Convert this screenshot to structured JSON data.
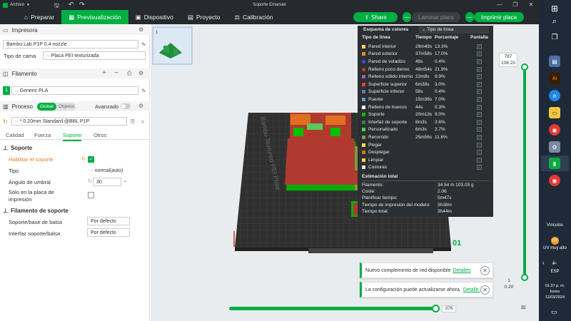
{
  "titlebar": {
    "menu_label": "Archivo",
    "title": "Soporte Emanuel",
    "window_controls": [
      "—",
      "❐",
      "✕"
    ]
  },
  "nav": {
    "tabs": [
      {
        "label": "Preparar",
        "icon": "home-icon"
      },
      {
        "label": "Previsualización",
        "icon": "preview-icon",
        "active": true
      },
      {
        "label": "Dispositivo",
        "icon": "device-icon"
      },
      {
        "label": "Proyecto",
        "icon": "project-icon"
      },
      {
        "label": "Calibración",
        "icon": "calibration-icon"
      }
    ],
    "share_label": "Share",
    "laminate_label": "Laminar placa",
    "print_label": "Imprimir placa"
  },
  "printer": {
    "title": "Impresora",
    "name": "Bambu Lab P1P 0.4 nozzle",
    "bed_label": "Tipo de cama",
    "bed_value": "Placa PEI texturizada"
  },
  "filament": {
    "title": "Filamento",
    "slot": "1",
    "value": "Generic PLA"
  },
  "process": {
    "title": "Proceso",
    "toggle_global": "Global",
    "toggle_objects": "Objetos",
    "advanced_label": "Avanzado",
    "profile": "* 0.20mm Standard @BBL P1P",
    "tabs": [
      "Calidad",
      "Fuerza",
      "Soporte",
      "Otros"
    ],
    "active_tab": "Soporte"
  },
  "support": {
    "section_title": "Soporte",
    "enable_label": "Habilitar el soporte",
    "type_label": "Tipo",
    "type_value": "normal(auto)",
    "threshold_label": "Ángulo de umbral",
    "threshold_value": "30",
    "threshold_unit": "°",
    "only_plate_label_1": "Sólo en la placa de",
    "only_plate_label_2": "impresión",
    "filament_section_title": "Filamento de soporte",
    "base_label": "Soporte/base de balsa",
    "base_value": "Por defecto",
    "interface_label": "Interfaz soporte/balsa",
    "interface_value": "Por defecto"
  },
  "plate_thumb_number": "1",
  "plate_text": "Bambu Textured PEI Plate",
  "plate_number": "01",
  "color_scheme": {
    "title": "Esquema de colores",
    "dropdown": "Tipo de línea",
    "headers": [
      "Tipo de línea",
      "Tiempo",
      "Porcentaje",
      "Pantalla"
    ],
    "rows": [
      {
        "name": "Pared interior",
        "time": "29m49s",
        "pct": "13.3%",
        "color": "#f8d35e",
        "shown": true
      },
      {
        "name": "Pared exterior",
        "time": "37m58s",
        "pct": "17.0%",
        "color": "#ff7f27",
        "shown": true
      },
      {
        "name": "Pared de voladizo",
        "time": "49s",
        "pct": "0.4%",
        "color": "#3548c8",
        "shown": true
      },
      {
        "name": "Relleno poco denso",
        "time": "48m54s",
        "pct": "21.9%",
        "color": "#b03a2e",
        "shown": true
      },
      {
        "name": "Relleno sólido interno",
        "time": "22m8s",
        "pct": "9.9%",
        "color": "#9b59b6",
        "shown": true
      },
      {
        "name": "Superficie superior",
        "time": "6m38s",
        "pct": "3.0%",
        "color": "#e03c3c",
        "shown": true
      },
      {
        "name": "Superficie inferior",
        "time": "58s",
        "pct": "0.4%",
        "color": "#6478b4",
        "shown": true
      },
      {
        "name": "Puente",
        "time": "15m36s",
        "pct": "7.0%",
        "color": "#4f9fd6",
        "shown": true
      },
      {
        "name": "Relleno de huecos",
        "time": "44s",
        "pct": "0.3%",
        "color": "#ffffff",
        "shown": true
      },
      {
        "name": "Soporte",
        "time": "20m13s",
        "pct": "9.0%",
        "color": "#00c000",
        "shown": true
      },
      {
        "name": "Interfaz de soporte",
        "time": "8m3s",
        "pct": "3.6%",
        "color": "#2e8b2e",
        "shown": true
      },
      {
        "name": "Personalizado",
        "time": "6m3s",
        "pct": "2.7%",
        "color": "#5ac85a",
        "shown": true
      },
      {
        "name": "Recorrido",
        "time": "25m56s",
        "pct": "11.6%",
        "color": "#7a9c3c",
        "shown": true
      },
      {
        "name": "Plegar",
        "time": "",
        "pct": "",
        "color": "#f0e040",
        "shown": false
      },
      {
        "name": "Desplegar",
        "time": "",
        "pct": "",
        "color": "#e07020",
        "shown": false
      },
      {
        "name": "Limpiar",
        "time": "",
        "pct": "",
        "color": "#f0d050",
        "shown": false
      },
      {
        "name": "Costuras",
        "time": "",
        "pct": "",
        "color": "#e0e0e0",
        "shown": true
      }
    ],
    "estimate_title": "Estimación total",
    "estimates": [
      {
        "label": "Filamento:",
        "value": "34.54 m    103.03 g"
      },
      {
        "label": "Coste:",
        "value": "2.06"
      },
      {
        "label": "Planificar tiempo:",
        "value": "5m47s"
      },
      {
        "label": "Tiempo de impresión del modelo:",
        "value": "3h38m"
      },
      {
        "label": "Tiempo total:",
        "value": "3h44m"
      }
    ]
  },
  "layer_slider": {
    "top_value": "787",
    "top_height": "108.20",
    "bottom_value": "1",
    "bottom_height": "0.20"
  },
  "move_slider": {
    "value": "376"
  },
  "notifications": [
    {
      "text": "Nuevo complemento de red disponible",
      "link": "Detalles"
    },
    {
      "text": "La configuración puede actualizarse ahora.",
      "link": "Detalle."
    }
  ],
  "taskbar": {
    "links_label": "Vínculos",
    "uv_label": "UV muy alto",
    "lang": "ESP",
    "time": "01:37 p. m.",
    "day": "lunes",
    "date": "11/03/2024"
  }
}
